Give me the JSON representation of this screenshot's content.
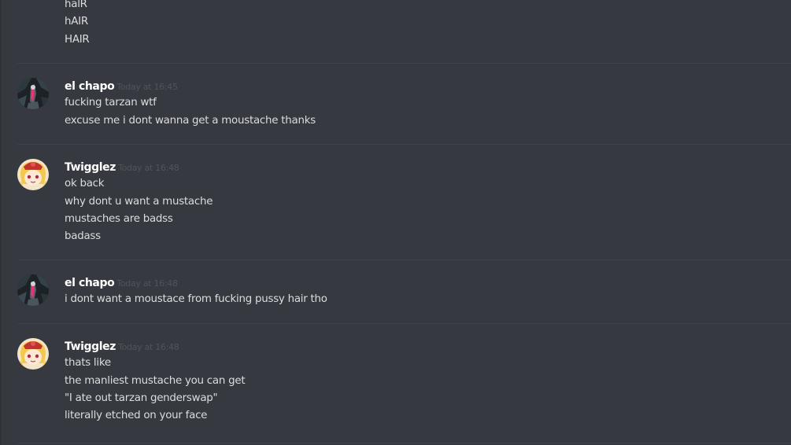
{
  "colors": {
    "background": "#36393f",
    "divider": "#3f4248",
    "username": "#ffffff",
    "timestamp": "#4f545c",
    "message_text": "#dcddde"
  },
  "partial_group": {
    "lines": [
      "halR",
      "hAIR",
      "HAIR"
    ]
  },
  "messages": [
    {
      "author": "el chapo",
      "avatar": "el-chapo-avatar",
      "timestamp": "Today at 16:45",
      "lines": [
        "fucking tarzan wtf",
        "excuse me i dont wanna get a moustache thanks"
      ]
    },
    {
      "author": "Twigglez",
      "avatar": "twigglez-avatar",
      "timestamp": "Today at 16:48",
      "lines": [
        "ok back",
        "why dont u want a mustache",
        "mustaches are badss",
        "badass"
      ]
    },
    {
      "author": "el chapo",
      "avatar": "el-chapo-avatar",
      "timestamp": "Today at 16:48",
      "lines": [
        "i dont want a moustace from fucking pussy hair tho"
      ]
    },
    {
      "author": "Twigglez",
      "avatar": "twigglez-avatar",
      "timestamp": "Today at 16:48",
      "lines": [
        "thats like",
        "the manliest mustache you can get",
        "\"I ate out tarzan genderswap\"",
        "literally etched on your face"
      ]
    }
  ]
}
